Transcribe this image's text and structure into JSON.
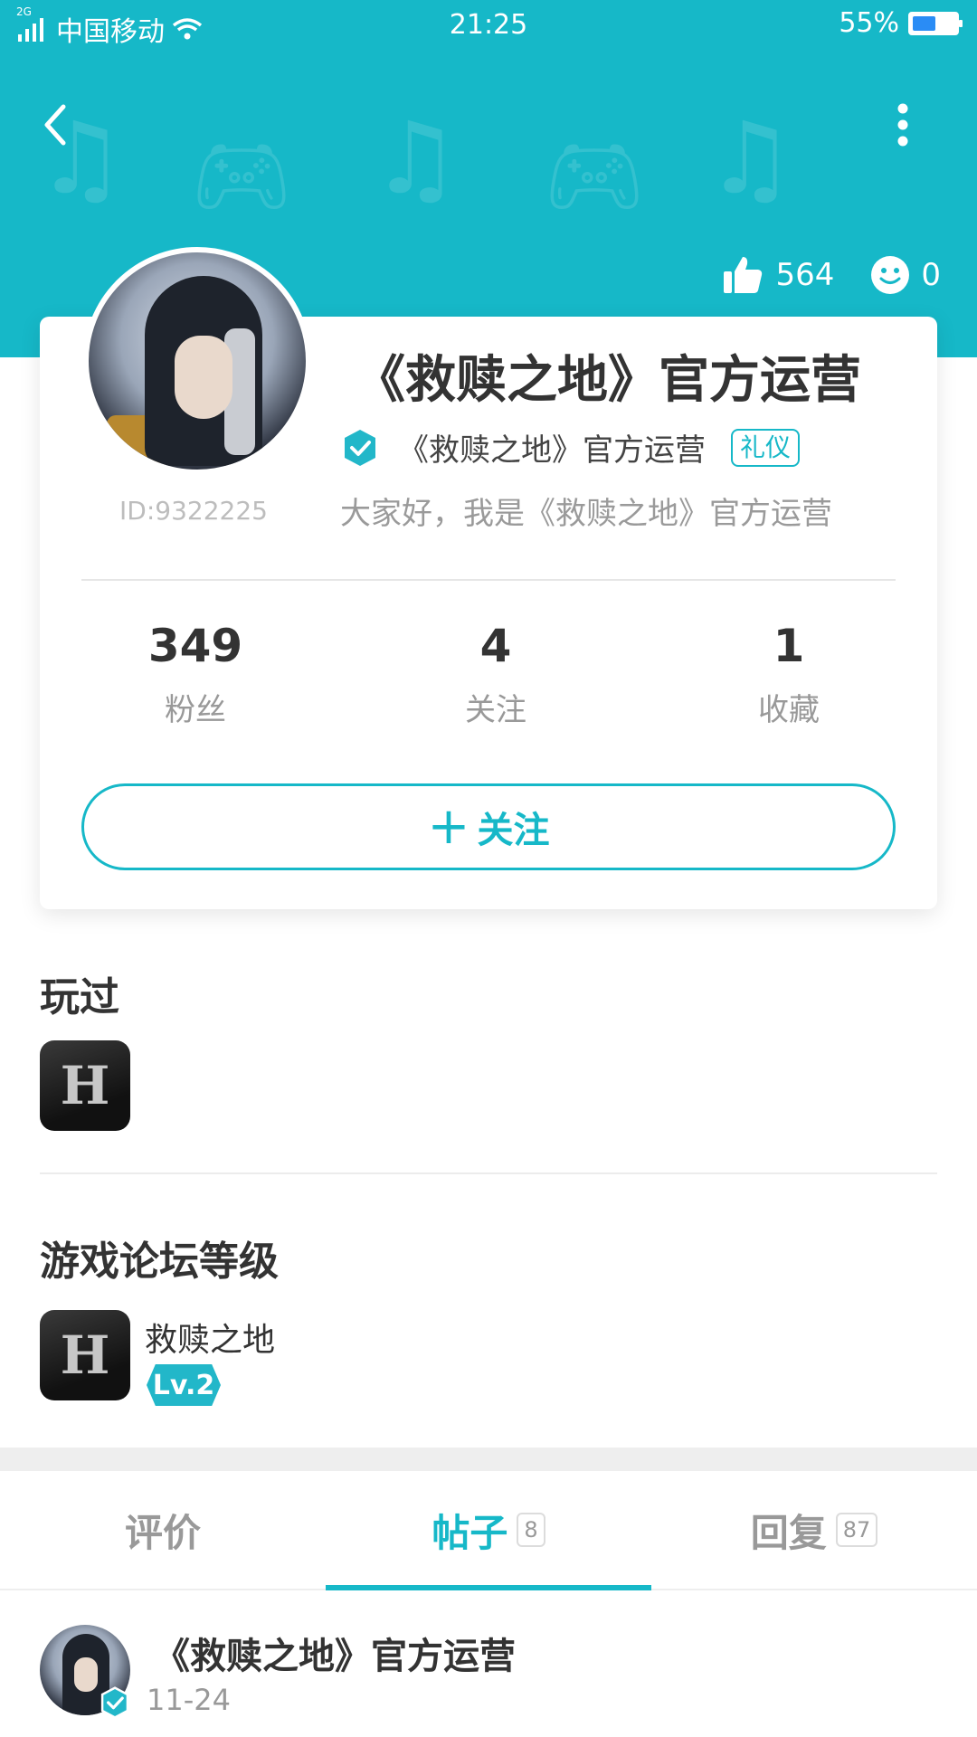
{
  "status_bar": {
    "network": "2G",
    "carrier": "中国移动",
    "time": "21:25",
    "battery": "55%",
    "battery_level": 0.55
  },
  "header": {
    "likes": "564",
    "smiles": "0"
  },
  "profile": {
    "id_label": "ID:9322225",
    "name": "《救赎之地》官方运营",
    "verified_name": "《救赎之地》官方运营",
    "tag": "礼仪",
    "bio": "大家好，我是《救赎之地》官方运营"
  },
  "stats": [
    {
      "value": "349",
      "label": "粉丝"
    },
    {
      "value": "4",
      "label": "关注"
    },
    {
      "value": "1",
      "label": "收藏"
    }
  ],
  "follow_button": {
    "plus": "+",
    "label": "关注"
  },
  "played": {
    "title": "玩过",
    "game_icon_letter": "H"
  },
  "forum_level": {
    "title": "游戏论坛等级",
    "game_icon_letter": "H",
    "game_name": "救赎之地",
    "level": "Lv.2"
  },
  "tabs": [
    {
      "label": "评价",
      "count": ""
    },
    {
      "label": "帖子",
      "count": "8"
    },
    {
      "label": "回复",
      "count": "87"
    }
  ],
  "post": {
    "author": "《救赎之地》官方运营",
    "date": "11-24"
  },
  "colors": {
    "accent": "#16b8c8",
    "battery_fill": "#2a8cf5"
  }
}
